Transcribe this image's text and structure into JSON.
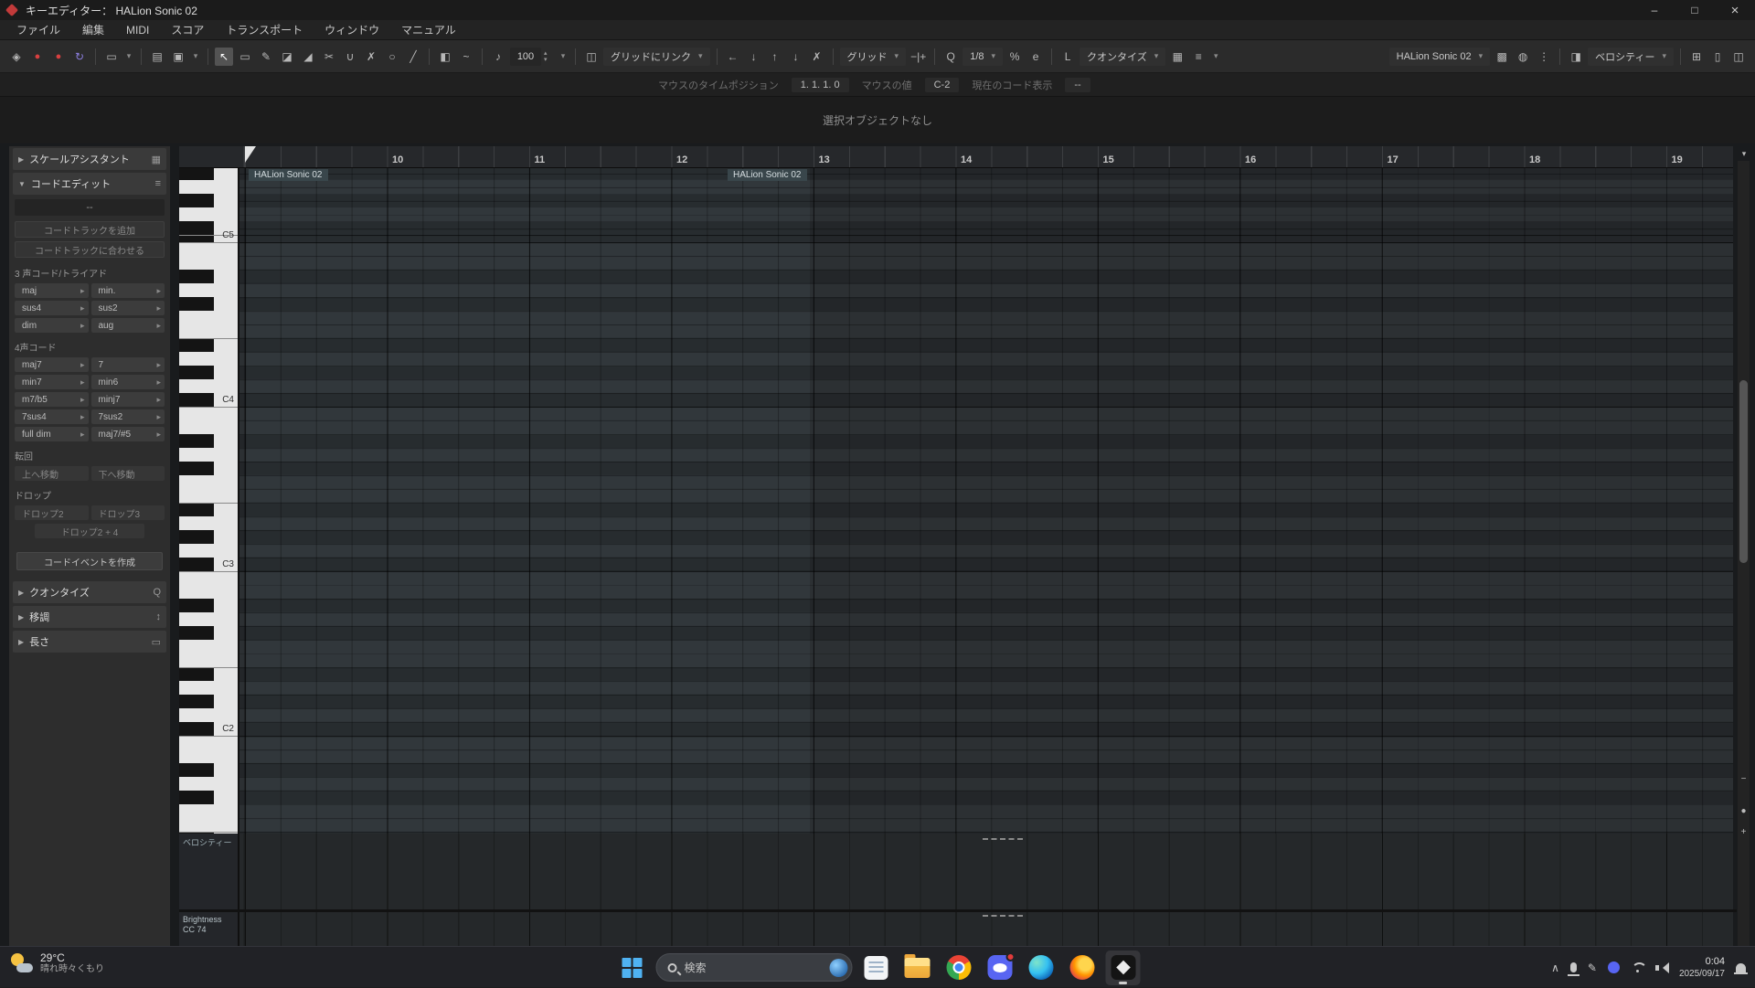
{
  "titlebar": {
    "title": "キーエディター： HALion Sonic 02"
  },
  "menubar": {
    "items": [
      "ファイル",
      "編集",
      "MIDI",
      "スコア",
      "トランスポート",
      "ウィンドウ",
      "マニュアル"
    ]
  },
  "toolbar": {
    "velocity_value": "100",
    "grid_link": "グリッドにリンク",
    "grid_type": "グリッド",
    "quantize_preset": "1/8",
    "length_quantize": "クオンタイズ",
    "track": "HALion Sonic 02",
    "event_colors": "ベロシティー"
  },
  "infoline": {
    "mouse_time_label": "マウスのタイムポジション",
    "mouse_time": "1. 1. 1. 0",
    "mouse_value_label": "マウスの値",
    "mouse_value": "C-2",
    "chord_label": "現在のコード表示",
    "chord_value": "--"
  },
  "statusline": {
    "text": "選択オブジェクトなし"
  },
  "panel": {
    "scale_assistant": "スケールアシスタント",
    "chord_edit": "コードエディット",
    "chord_display": "--",
    "add_chord_track": "コードトラックを追加",
    "match_chord_track": "コードトラックに合わせる",
    "triads_label": "3 声コード/トライアド",
    "triads": [
      "maj",
      "min.",
      "sus4",
      "sus2",
      "dim",
      "aug"
    ],
    "tetrads_label": "4声コード",
    "tetrads": [
      "maj7",
      "7",
      "min7",
      "min6",
      "m7/b5",
      "minj7",
      "7sus4",
      "7sus2",
      "full dim",
      "maj7/#5"
    ],
    "inversion_label": "転回",
    "inversions": [
      "上へ移動",
      "下へ移動"
    ],
    "drop_label": "ドロップ",
    "drops": [
      "ドロップ2",
      "ドロップ3"
    ],
    "drop_wide": "ドロップ2 + 4",
    "create_chord_event": "コードイベントを作成",
    "quantize": "クオンタイズ",
    "transpose": "移調",
    "length": "長さ"
  },
  "ruler": {
    "measures": [
      "10",
      "11",
      "12",
      "13",
      "14",
      "15",
      "16",
      "17",
      "18",
      "19"
    ]
  },
  "piano": {
    "labels": [
      "C5",
      "C4",
      "C3",
      "C2"
    ]
  },
  "parts": [
    {
      "label": "HALion Sonic 02"
    },
    {
      "label": "HALion Sonic 02"
    }
  ],
  "lanes": {
    "velocity": "ベロシティー",
    "cc_name": "Brightness",
    "cc_num": "CC 74"
  },
  "taskbar": {
    "temp": "29°C",
    "weather": "晴れ時々くもり",
    "search": "検索",
    "time": "0:04",
    "date": "2025/09/17"
  },
  "icons": {
    "pin": "◈",
    "record": "●",
    "loop": "↻",
    "obj_select": "▭",
    "auto_select": "▤",
    "edit_active_part": "▣",
    "select_tool": "↖",
    "range_tool": "▭",
    "draw_tool": "✎",
    "erase_tool": "◪",
    "trim_tool": "◢",
    "split_tool": "✂",
    "glue_tool": "∪",
    "mute_tool": "✗",
    "zoom_tool": "○",
    "line_tool": "╱",
    "info": "◧",
    "curve": "~",
    "speaker": "♪",
    "snap": "◫",
    "nudge_left": "←",
    "nudge_down": "↓",
    "nudge_up": "↑",
    "cross": "✗",
    "pm": "−|+",
    "quantize_q": "Q",
    "swing": "%",
    "iq": "e",
    "lq": "L",
    "piano_icon": "▦",
    "layers": "≡",
    "grid_icon": "▩",
    "globe": "◍",
    "dots": "⋮",
    "colors": "◨",
    "win_a": "⊞",
    "win_b": "▯",
    "win_c": "◫",
    "scale_assist": "▦",
    "chord_edit_icon": "≡",
    "panel_q": "Q",
    "panel_transpose": "↕",
    "panel_length": "▭",
    "ruler_menu": "▾",
    "zoom_out": "−",
    "zoom_dot": "●",
    "zoom_in": "+"
  }
}
